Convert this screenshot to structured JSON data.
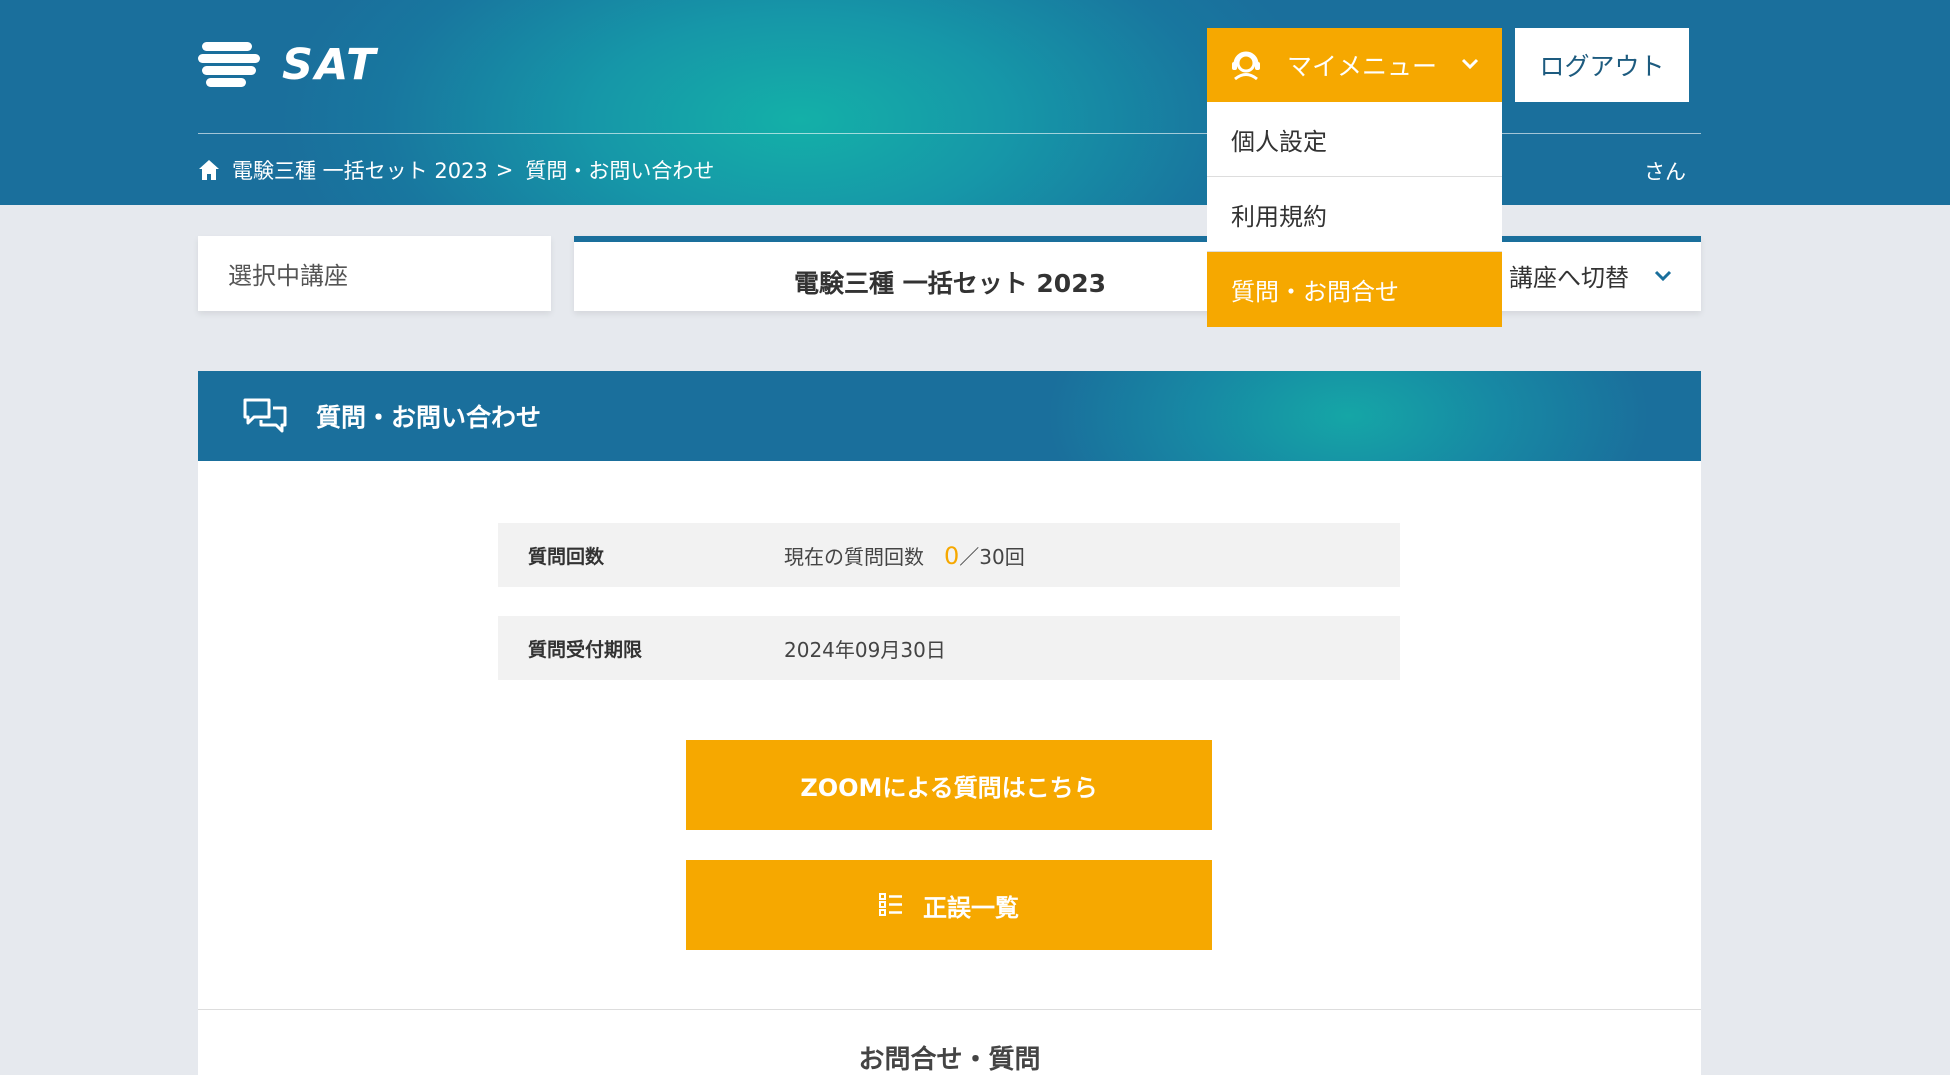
{
  "header": {
    "logo_text": "SAT",
    "breadcrumb": {
      "course": "電験三種 一括セット 2023",
      "separator": ">",
      "current": "質問・お問い合わせ"
    },
    "user_suffix": "さん",
    "mymenu_label": "マイメニュー",
    "logout_label": "ログアウト"
  },
  "dropdown": {
    "items": [
      {
        "label": "個人設定"
      },
      {
        "label": "利用規約"
      },
      {
        "label": "質問・お問合せ"
      }
    ]
  },
  "course_selector": {
    "label": "選択中講座",
    "course": "電験三種 一括セット 2023",
    "switch_label": "講座へ切替"
  },
  "panel": {
    "title": "質問・お問い合わせ",
    "question_count": {
      "label": "質問回数",
      "prefix": "現在の質問回数",
      "current": "0",
      "max": "／30回"
    },
    "deadline": {
      "label": "質問受付期限",
      "value": "2024年09月30日"
    },
    "zoom_button": "ZOOMによる質問はこちら",
    "errata_button": "正誤一覧",
    "bottom_title": "お問合せ・質問"
  },
  "colors": {
    "accent": "#f6a800",
    "header": "#1a6f9c",
    "teal": "#14b0a8"
  },
  "icons": [
    "home-icon",
    "headset-icon",
    "chevron-down-icon",
    "chat-bubbles-icon",
    "checklist-icon"
  ]
}
